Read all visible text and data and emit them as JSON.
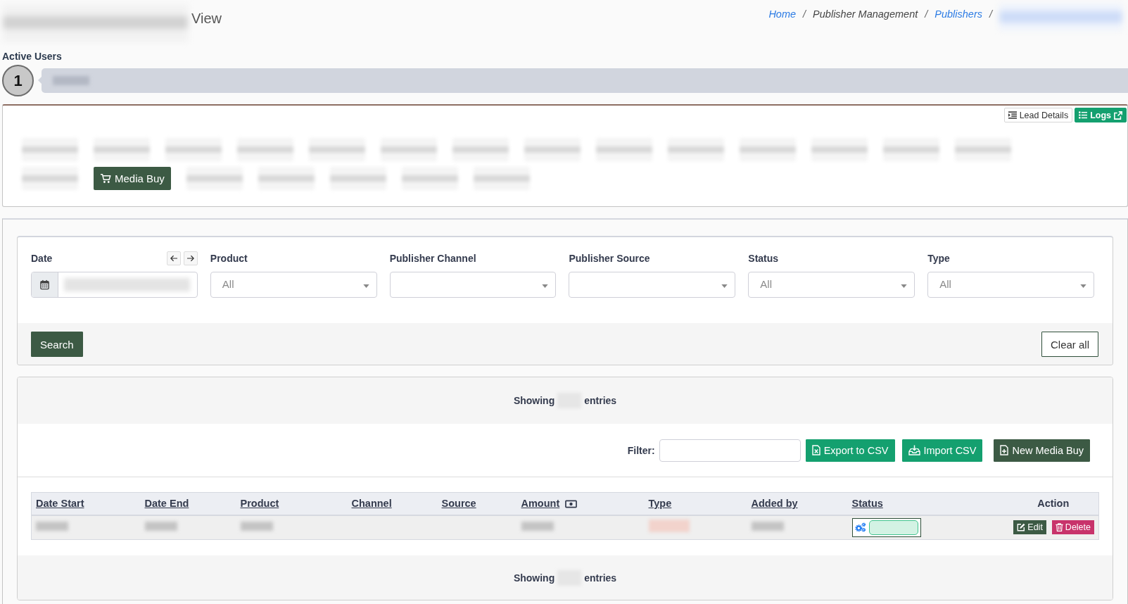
{
  "header": {
    "title": [
      {
        "kind": "blurred"
      },
      {
        "kind": "text",
        "text": "View"
      }
    ],
    "breadcrumb_separator": "/",
    "breadcrumb": [
      {
        "kind": "link",
        "label": "Home"
      },
      {
        "kind": "text",
        "label": "Publisher Management"
      },
      {
        "kind": "link",
        "label": "Publishers"
      },
      {
        "kind": "blurred"
      }
    ]
  },
  "active_users": {
    "label": "Active Users",
    "count": "1",
    "users": [
      {
        "kind": "blurred"
      }
    ]
  },
  "panel_buttons": [
    {
      "kind": "light",
      "label": "Lead Details"
    },
    {
      "kind": "green",
      "label": "Logs"
    }
  ],
  "tabs": [
    {
      "kind": "blurred",
      "selected": false
    },
    {
      "kind": "blurred",
      "selected": false
    },
    {
      "kind": "blurred",
      "selected": false
    },
    {
      "kind": "blurred",
      "selected": false
    },
    {
      "kind": "blurred",
      "selected": false
    },
    {
      "kind": "blurred",
      "selected": false
    },
    {
      "kind": "blurred",
      "selected": false
    },
    {
      "kind": "blurred",
      "selected": false
    },
    {
      "kind": "blurred",
      "selected": false
    },
    {
      "kind": "blurred",
      "selected": false
    },
    {
      "kind": "blurred",
      "selected": false
    },
    {
      "kind": "blurred",
      "selected": false
    },
    {
      "kind": "blurred",
      "selected": false
    },
    {
      "kind": "blurred",
      "selected": false
    },
    {
      "kind": "blurred",
      "selected": false
    },
    {
      "kind": "label",
      "label": "Media Buy",
      "selected": true
    },
    {
      "kind": "blurred",
      "selected": false
    },
    {
      "kind": "blurred",
      "selected": false
    },
    {
      "kind": "blurred",
      "selected": false
    },
    {
      "kind": "blurred",
      "selected": false
    },
    {
      "kind": "blurred",
      "selected": false
    }
  ],
  "filters": {
    "fields": [
      {
        "kind": "daterange",
        "label": "Date"
      },
      {
        "kind": "select",
        "label": "Product",
        "placeholder": "All"
      },
      {
        "kind": "select",
        "label": "Publisher Channel"
      },
      {
        "kind": "select",
        "label": "Publisher Source"
      },
      {
        "kind": "select",
        "label": "Status",
        "placeholder": "All"
      },
      {
        "kind": "select",
        "label": "Type",
        "placeholder": "All"
      }
    ],
    "buttons": [
      {
        "kind": "primary",
        "label": "Search"
      },
      {
        "kind": "outline",
        "label": "Clear all"
      }
    ]
  },
  "table_panel": {
    "summary_top": {
      "before": "Showing",
      "after": "entries"
    },
    "filter_label": "Filter:",
    "actions": [
      {
        "kind": "export",
        "label": "Export to CSV"
      },
      {
        "kind": "import",
        "label": "Import CSV"
      },
      {
        "kind": "new",
        "label": "New Media Buy"
      }
    ],
    "columns": [
      {
        "kind": "sortable",
        "label": "Date Start"
      },
      {
        "kind": "sortable",
        "label": "Date End"
      },
      {
        "kind": "sortable",
        "label": "Product"
      },
      {
        "kind": "sortable",
        "label": "Channel"
      },
      {
        "kind": "sortable",
        "label": "Source"
      },
      {
        "kind": "sortable-amount",
        "label": "Amount"
      },
      {
        "kind": "sortable",
        "label": "Type"
      },
      {
        "kind": "sortable",
        "label": "Added by"
      },
      {
        "kind": "sortable",
        "label": "Status"
      },
      {
        "kind": "plain",
        "label": "Action"
      }
    ],
    "rows": [
      {
        "cells": [
          {
            "kind": "blurred"
          },
          {
            "kind": "blurred"
          },
          {
            "kind": "blurred"
          },
          {
            "kind": "blank"
          },
          {
            "kind": "blank"
          },
          {
            "kind": "blurred"
          },
          {
            "kind": "blurred-badge"
          },
          {
            "kind": "blurred"
          },
          {
            "kind": "status-select"
          },
          {
            "kind": "actions",
            "buttons": [
              {
                "kind": "edit",
                "label": "Edit"
              },
              {
                "kind": "delete",
                "label": "Delete"
              }
            ]
          }
        ]
      }
    ],
    "summary_bottom": {
      "before": "Showing",
      "after": "entries"
    }
  }
}
